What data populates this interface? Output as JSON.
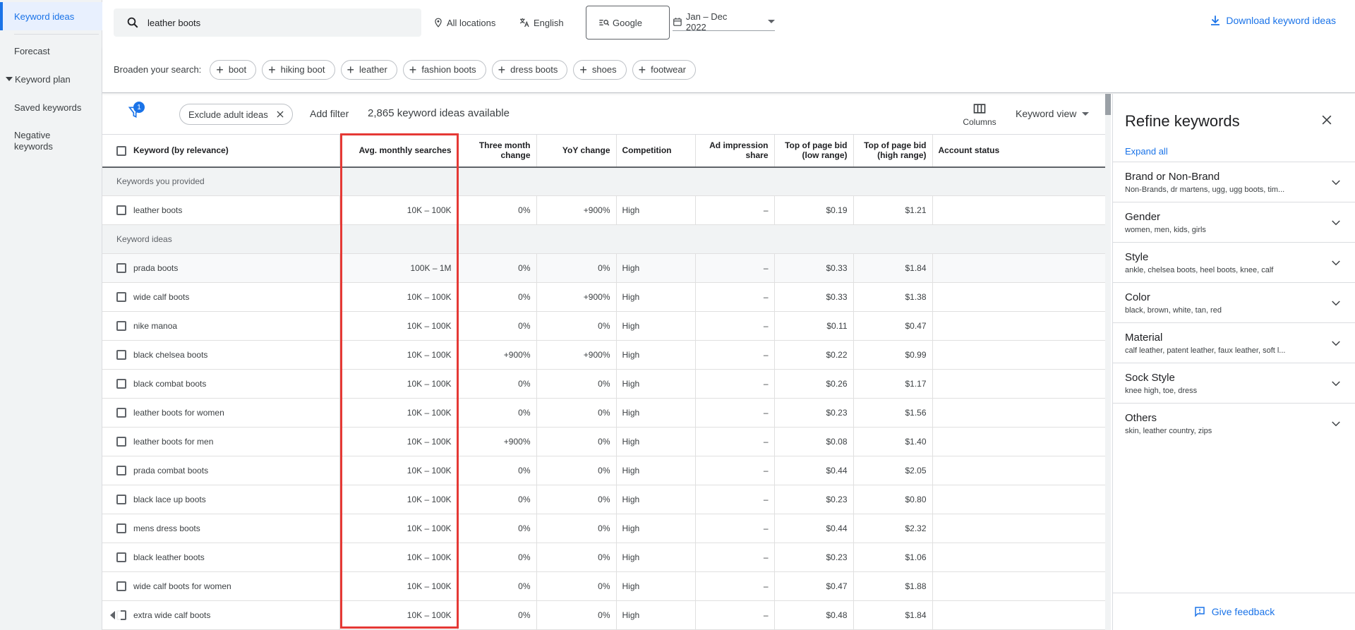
{
  "sidebar": {
    "items": [
      {
        "label": "Keyword ideas"
      },
      {
        "label": "Forecast"
      },
      {
        "label": "Keyword plan"
      },
      {
        "label": "Saved keywords"
      },
      {
        "label": "Negative keywords"
      }
    ]
  },
  "topbar": {
    "search_value": "leather boots",
    "location": "All locations",
    "language": "English",
    "network": "Google",
    "date_range": "Jan – Dec 2022",
    "download_label": "Download keyword ideas"
  },
  "broaden": {
    "label": "Broaden your search:",
    "chips": [
      "boot",
      "hiking boot",
      "leather",
      "fashion boots",
      "dress boots",
      "shoes",
      "footwear"
    ]
  },
  "filters": {
    "badge": "1",
    "chip": "Exclude adult ideas",
    "add_filter": "Add filter",
    "available": "2,865 keyword ideas available",
    "columns": "Columns",
    "view": "Keyword view"
  },
  "table": {
    "headers": {
      "keyword": "Keyword (by relevance)",
      "avg": "Avg. monthly searches",
      "three_month": "Three month change",
      "yoy": "YoY change",
      "competition": "Competition",
      "ad_share": "Ad impression share",
      "bid_low": "Top of page bid (low range)",
      "bid_high": "Top of page bid (high range)",
      "account": "Account status"
    },
    "group_provided": "Keywords you provided",
    "group_ideas": "Keyword ideas",
    "provided": [
      {
        "kw": "leather boots",
        "avg": "10K – 100K",
        "three": "0%",
        "yoy": "+900%",
        "comp": "High",
        "share": "–",
        "low": "$0.19",
        "high": "$1.21"
      }
    ],
    "ideas": [
      {
        "kw": "prada boots",
        "avg": "100K – 1M",
        "three": "0%",
        "yoy": "0%",
        "comp": "High",
        "share": "–",
        "low": "$0.33",
        "high": "$1.84"
      },
      {
        "kw": "wide calf boots",
        "avg": "10K – 100K",
        "three": "0%",
        "yoy": "+900%",
        "comp": "High",
        "share": "–",
        "low": "$0.33",
        "high": "$1.38"
      },
      {
        "kw": "nike manoa",
        "avg": "10K – 100K",
        "three": "0%",
        "yoy": "0%",
        "comp": "High",
        "share": "–",
        "low": "$0.11",
        "high": "$0.47"
      },
      {
        "kw": "black chelsea boots",
        "avg": "10K – 100K",
        "three": "+900%",
        "yoy": "+900%",
        "comp": "High",
        "share": "–",
        "low": "$0.22",
        "high": "$0.99"
      },
      {
        "kw": "black combat boots",
        "avg": "10K – 100K",
        "three": "0%",
        "yoy": "0%",
        "comp": "High",
        "share": "–",
        "low": "$0.26",
        "high": "$1.17"
      },
      {
        "kw": "leather boots for women",
        "avg": "10K – 100K",
        "three": "0%",
        "yoy": "0%",
        "comp": "High",
        "share": "–",
        "low": "$0.23",
        "high": "$1.56"
      },
      {
        "kw": "leather boots for men",
        "avg": "10K – 100K",
        "three": "+900%",
        "yoy": "0%",
        "comp": "High",
        "share": "–",
        "low": "$0.08",
        "high": "$1.40"
      },
      {
        "kw": "prada combat boots",
        "avg": "10K – 100K",
        "three": "0%",
        "yoy": "0%",
        "comp": "High",
        "share": "–",
        "low": "$0.44",
        "high": "$2.05"
      },
      {
        "kw": "black lace up boots",
        "avg": "10K – 100K",
        "three": "0%",
        "yoy": "0%",
        "comp": "High",
        "share": "–",
        "low": "$0.23",
        "high": "$0.80"
      },
      {
        "kw": "mens dress boots",
        "avg": "10K – 100K",
        "three": "0%",
        "yoy": "0%",
        "comp": "High",
        "share": "–",
        "low": "$0.44",
        "high": "$2.32"
      },
      {
        "kw": "black leather boots",
        "avg": "10K – 100K",
        "three": "0%",
        "yoy": "0%",
        "comp": "High",
        "share": "–",
        "low": "$0.23",
        "high": "$1.06"
      },
      {
        "kw": "wide calf boots for women",
        "avg": "10K – 100K",
        "three": "0%",
        "yoy": "0%",
        "comp": "High",
        "share": "–",
        "low": "$0.47",
        "high": "$1.88"
      },
      {
        "kw": "extra wide calf boots",
        "avg": "10K – 100K",
        "three": "0%",
        "yoy": "0%",
        "comp": "High",
        "share": "–",
        "low": "$0.48",
        "high": "$1.84"
      }
    ]
  },
  "refine": {
    "title": "Refine keywords",
    "expand_all": "Expand all",
    "items": [
      {
        "title": "Brand or Non-Brand",
        "sub": "Non-Brands, dr martens, ugg, ugg boots, tim..."
      },
      {
        "title": "Gender",
        "sub": "women, men, kids, girls"
      },
      {
        "title": "Style",
        "sub": "ankle, chelsea boots, heel boots, knee, calf"
      },
      {
        "title": "Color",
        "sub": "black, brown, white, tan, red"
      },
      {
        "title": "Material",
        "sub": "calf leather, patent leather, faux leather, soft l..."
      },
      {
        "title": "Sock Style",
        "sub": "knee high, toe, dress"
      },
      {
        "title": "Others",
        "sub": "skin, leather country, zips"
      }
    ],
    "feedback": "Give feedback"
  },
  "colors": {
    "accent": "#1a73e8",
    "highlight": "#e53935"
  }
}
